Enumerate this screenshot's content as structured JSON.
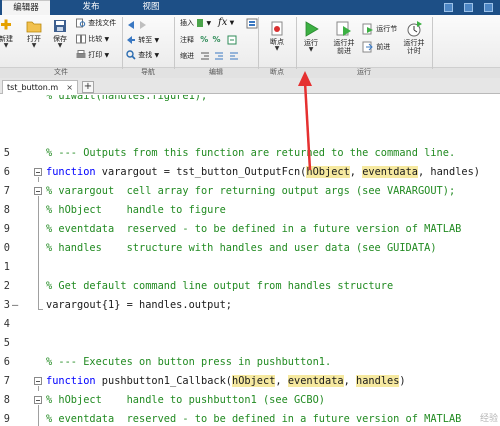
{
  "tabs": [
    "编辑器",
    "发布",
    "视图"
  ],
  "ribbon": {
    "file_group": {
      "label": "文件",
      "new": "新建",
      "open": "打开",
      "save": "保存",
      "find_files": "查找文件",
      "compare": "比较",
      "print": "打印"
    },
    "nav_group": {
      "label": "导航",
      "goto": "转至",
      "find": "查找"
    },
    "edit_group": {
      "label": "编辑",
      "insert": "插入",
      "fx": "fx",
      "comment": "注释",
      "indent": "缩进"
    },
    "breakpoint_group": {
      "label": "断点",
      "breakpoints": "断点"
    },
    "run_group": {
      "label": "运行",
      "run": "运行",
      "run_advance": "运行并\n前进",
      "run_section": "运行节",
      "advance": "前进",
      "run_time": "运行并\n计时"
    }
  },
  "file_tab": {
    "name": "tst_button.m",
    "close": "×",
    "add": "+"
  },
  "code": {
    "lines": [
      {
        "num": "",
        "dash": false,
        "fold": "",
        "segments": [
          {
            "t": "% uiwait(handles.figure1);",
            "c": "cm"
          }
        ]
      },
      {
        "num": "",
        "dash": false,
        "fold": "",
        "segments": []
      },
      {
        "num": "",
        "dash": false,
        "fold": "",
        "segments": []
      },
      {
        "num": "5",
        "dash": false,
        "fold": "",
        "segments": [
          {
            "t": "% --- Outputs from this function are returned to the command line.",
            "c": "cm"
          }
        ]
      },
      {
        "num": "6",
        "dash": false,
        "fold": "box",
        "segments": [
          {
            "t": "function",
            "c": "kw"
          },
          {
            "t": " varargout = tst_button_OutputFcn(",
            "c": "tx"
          },
          {
            "t": "hObject",
            "c": "hl"
          },
          {
            "t": ", ",
            "c": "tx"
          },
          {
            "t": "eventdata",
            "c": "hl"
          },
          {
            "t": ", handles)",
            "c": "tx"
          }
        ]
      },
      {
        "num": "7",
        "dash": false,
        "fold": "box",
        "segments": [
          {
            "t": "% varargout  cell array for returning output args (see VARARGOUT);",
            "c": "cm"
          }
        ]
      },
      {
        "num": "8",
        "dash": false,
        "fold": "line",
        "segments": [
          {
            "t": "% hObject    handle to figure",
            "c": "cm"
          }
        ]
      },
      {
        "num": "9",
        "dash": false,
        "fold": "line",
        "segments": [
          {
            "t": "% eventdata  reserved - to be defined in a future version of MATLAB",
            "c": "cm"
          }
        ]
      },
      {
        "num": "0",
        "dash": false,
        "fold": "line",
        "segments": [
          {
            "t": "% handles    structure with handles and user data (see GUIDATA)",
            "c": "cm"
          }
        ]
      },
      {
        "num": "1",
        "dash": false,
        "fold": "line",
        "segments": []
      },
      {
        "num": "2",
        "dash": false,
        "fold": "line",
        "segments": [
          {
            "t": "% Get default command line output from handles structure",
            "c": "cm"
          }
        ]
      },
      {
        "num": "3",
        "dash": true,
        "fold": "end",
        "segments": [
          {
            "t": "varargout{1} = handles.output;",
            "c": "tx"
          }
        ]
      },
      {
        "num": "4",
        "dash": false,
        "fold": "",
        "segments": []
      },
      {
        "num": "5",
        "dash": false,
        "fold": "",
        "segments": []
      },
      {
        "num": "6",
        "dash": false,
        "fold": "",
        "segments": [
          {
            "t": "% --- Executes on button press in pushbutton1.",
            "c": "cm"
          }
        ]
      },
      {
        "num": "7",
        "dash": false,
        "fold": "box",
        "segments": [
          {
            "t": "function",
            "c": "kw"
          },
          {
            "t": " pushbutton1_Callback(",
            "c": "tx"
          },
          {
            "t": "hObject",
            "c": "hl"
          },
          {
            "t": ", ",
            "c": "tx"
          },
          {
            "t": "eventdata",
            "c": "hl"
          },
          {
            "t": ", ",
            "c": "tx"
          },
          {
            "t": "handles",
            "c": "hl"
          },
          {
            "t": ")",
            "c": "tx"
          }
        ]
      },
      {
        "num": "8",
        "dash": false,
        "fold": "box",
        "segments": [
          {
            "t": "% hObject    handle to pushbutton1 (see GCBO)",
            "c": "cm"
          }
        ]
      },
      {
        "num": "9",
        "dash": false,
        "fold": "line",
        "segments": [
          {
            "t": "% eventdata  reserved - to be defined in a future version of MATLAB",
            "c": "cm"
          }
        ]
      }
    ]
  },
  "watermark": "经验",
  "colors": {
    "titlebar": "#1d4f86",
    "comment": "#228b22",
    "keyword": "#0000ff",
    "highlight": "#f6e9a0",
    "annotation_arrow": "#e53030"
  }
}
